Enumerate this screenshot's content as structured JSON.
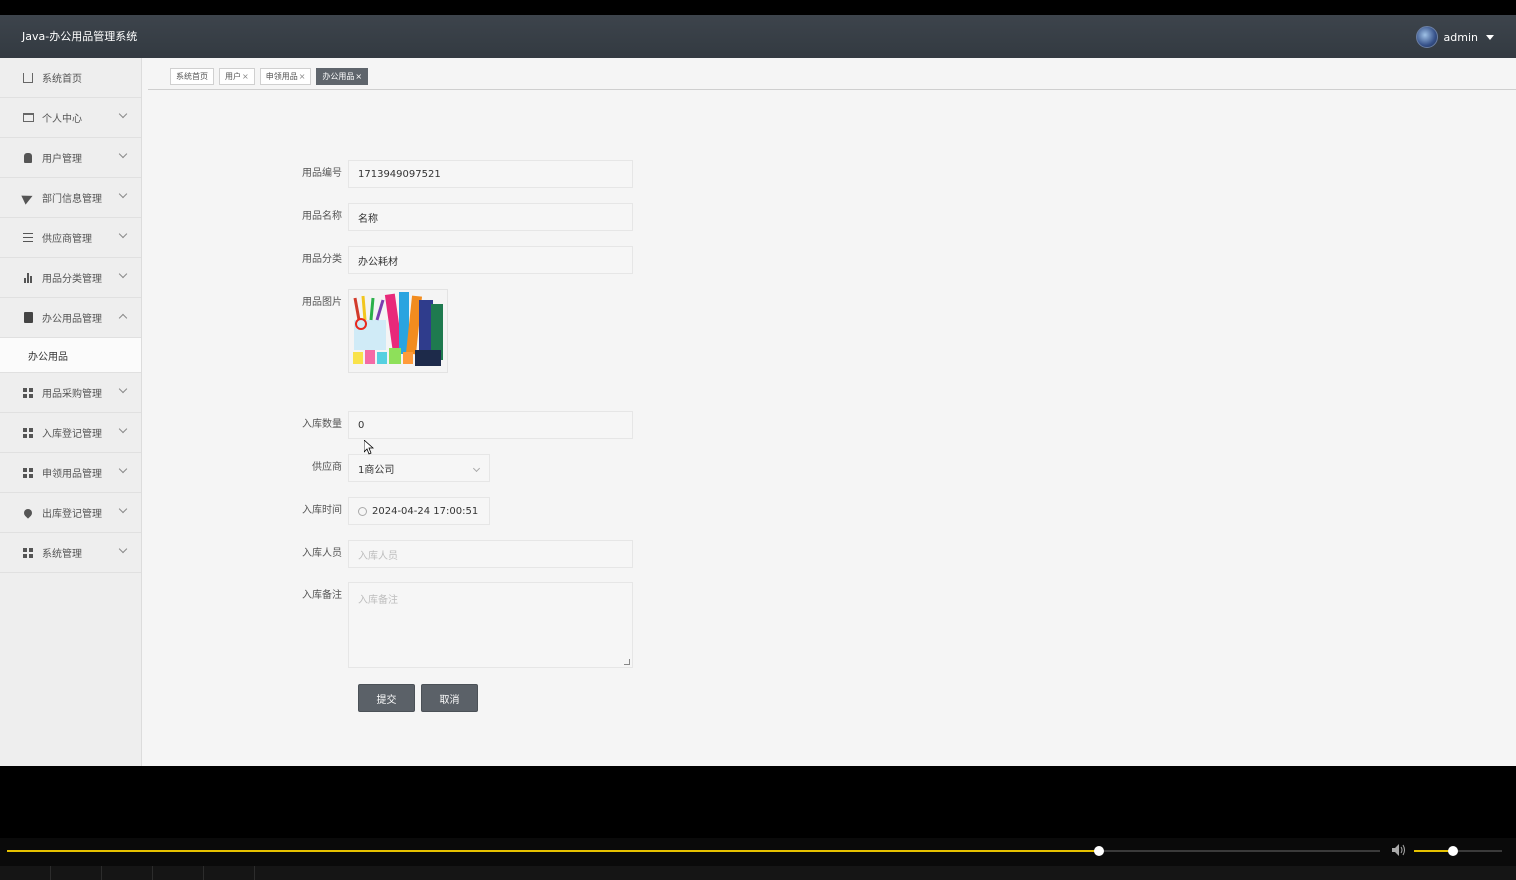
{
  "header": {
    "app_title": "Java-办公用品管理系统",
    "username": "admin"
  },
  "sidebar": {
    "items": [
      {
        "label": "系统首页",
        "icon": "home-icon"
      },
      {
        "label": "个人中心",
        "icon": "card-icon"
      },
      {
        "label": "用户管理",
        "icon": "user-icon"
      },
      {
        "label": "部门信息管理",
        "icon": "send-icon"
      },
      {
        "label": "供应商管理",
        "icon": "sliders-icon"
      },
      {
        "label": "用品分类管理",
        "icon": "bar-chart-icon"
      },
      {
        "label": "办公用品管理",
        "icon": "clipboard-icon",
        "expanded": true
      },
      {
        "label": "用品采购管理",
        "icon": "grid-icon"
      },
      {
        "label": "入库登记管理",
        "icon": "grid-icon"
      },
      {
        "label": "申领用品管理",
        "icon": "grid-icon"
      },
      {
        "label": "出库登记管理",
        "icon": "pin-icon"
      },
      {
        "label": "系统管理",
        "icon": "grid-icon"
      }
    ],
    "submenu_label": "办公用品"
  },
  "tabs": [
    {
      "label": "系统首页",
      "closable": false
    },
    {
      "label": "用户",
      "closable": true
    },
    {
      "label": "申领用品",
      "closable": true
    },
    {
      "label": "办公用品",
      "closable": true,
      "active": true
    }
  ],
  "tab_close_glyph": "×",
  "form": {
    "code_label": "用品编号",
    "code_value": "1713949097521",
    "name_label": "用品名称",
    "name_value": "名称",
    "category_label": "用品分类",
    "category_value": "办公耗材",
    "image_label": "用品图片",
    "qty_label": "入库数量",
    "qty_value": "0",
    "supplier_label": "供应商",
    "supplier_value": "1商公司",
    "time_label": "入库时间",
    "time_value": "2024-04-24 17:00:51",
    "person_label": "入库人员",
    "person_placeholder": "入库人员",
    "note_label": "入库备注",
    "note_placeholder": "入库备注",
    "submit_label": "提交",
    "cancel_label": "取消"
  },
  "player": {
    "progress": 0.795,
    "volume": 0.44,
    "accent_color": "#e5c100",
    "volume_icon": "speaker-icon"
  },
  "colors": {
    "topbar": "#394048",
    "active_tab": "#5f656c",
    "button": "#5b6168"
  }
}
